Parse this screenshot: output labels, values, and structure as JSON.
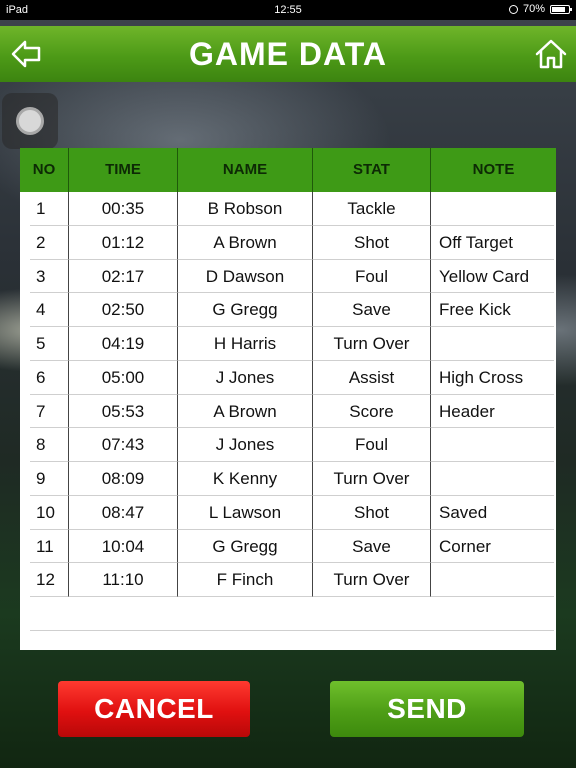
{
  "status_bar": {
    "device": "iPad",
    "time": "12:55",
    "battery": "70%"
  },
  "header": {
    "title": "GAME DATA"
  },
  "table": {
    "columns": [
      "NO",
      "TIME",
      "NAME",
      "STAT",
      "NOTE"
    ],
    "rows": [
      [
        "1",
        "00:35",
        "B Robson",
        "Tackle",
        ""
      ],
      [
        "2",
        "01:12",
        "A Brown",
        "Shot",
        "Off Target"
      ],
      [
        "3",
        "02:17",
        "D Dawson",
        "Foul",
        "Yellow Card"
      ],
      [
        "4",
        "02:50",
        "G Gregg",
        "Save",
        "Free Kick"
      ],
      [
        "5",
        "04:19",
        "H Harris",
        "Turn Over",
        ""
      ],
      [
        "6",
        "05:00",
        "J Jones",
        "Assist",
        "High Cross"
      ],
      [
        "7",
        "05:53",
        "A Brown",
        "Score",
        "Header"
      ],
      [
        "8",
        "07:43",
        "J Jones",
        "Foul",
        ""
      ],
      [
        "9",
        "08:09",
        "K Kenny",
        "Turn Over",
        ""
      ],
      [
        "10",
        "08:47",
        "L Lawson",
        "Shot",
        "Saved"
      ],
      [
        "11",
        "10:04",
        "G Gregg",
        "Save",
        "Corner"
      ],
      [
        "12",
        "11:10",
        "F Finch",
        "Turn Over",
        ""
      ]
    ]
  },
  "buttons": {
    "cancel": "CANCEL",
    "send": "SEND"
  },
  "icons": {
    "back": "back-arrow-icon",
    "home": "home-icon",
    "assistive": "assistive-touch-icon"
  },
  "colors": {
    "header_green": "#4d9a17",
    "cancel_red": "#e01010",
    "send_green": "#4e9e16"
  }
}
